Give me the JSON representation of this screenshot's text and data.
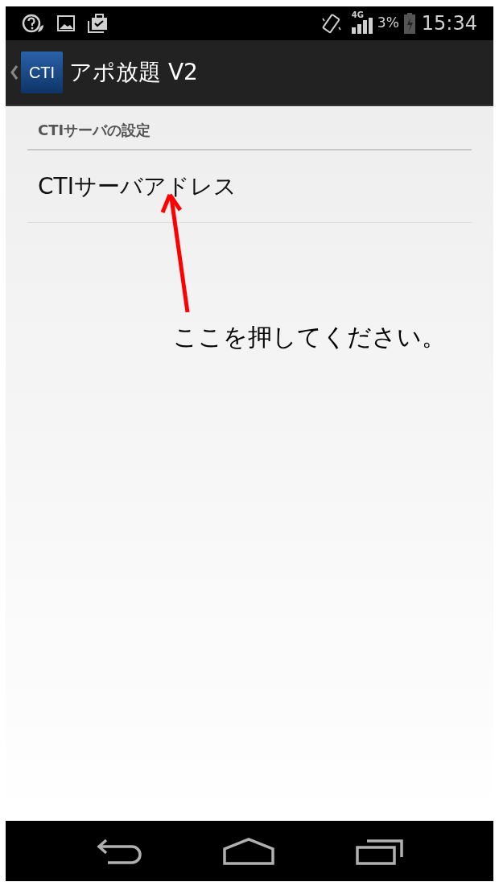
{
  "status_bar": {
    "battery": "3%",
    "network": "4G",
    "time": "15:34"
  },
  "action_bar": {
    "logo_text": "CTI",
    "title": "アポ放題 V2"
  },
  "settings": {
    "category": "CTIサーバの設定",
    "items": [
      {
        "title": "CTIサーバアドレス"
      }
    ]
  },
  "annotation": {
    "text": "ここを押してください。"
  }
}
